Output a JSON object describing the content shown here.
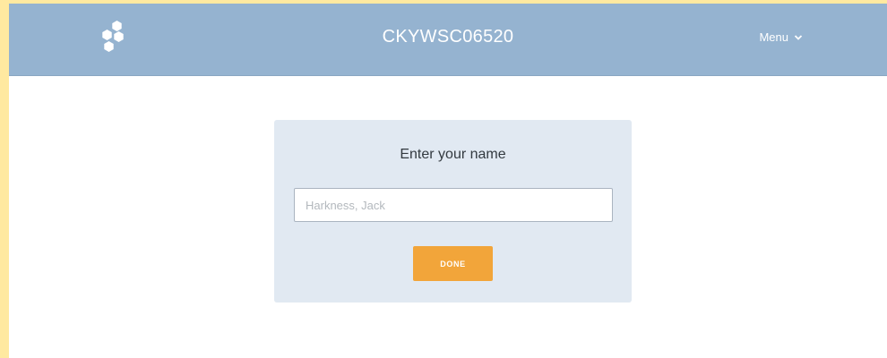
{
  "header": {
    "session_code": "CKYWSC06520",
    "menu_label": "Menu",
    "logo_icon": "hexagon-cluster-logo",
    "menu_icon": "chevron-down-icon"
  },
  "name_form": {
    "title": "Enter your name",
    "input_placeholder": "Harkness, Jack",
    "input_value": "",
    "done_label": "DONE"
  },
  "colors": {
    "page_border": "#ffe9a0",
    "header_bg": "#95b3d0",
    "card_bg": "#e1e9f2",
    "button_bg": "#f2a53a"
  }
}
